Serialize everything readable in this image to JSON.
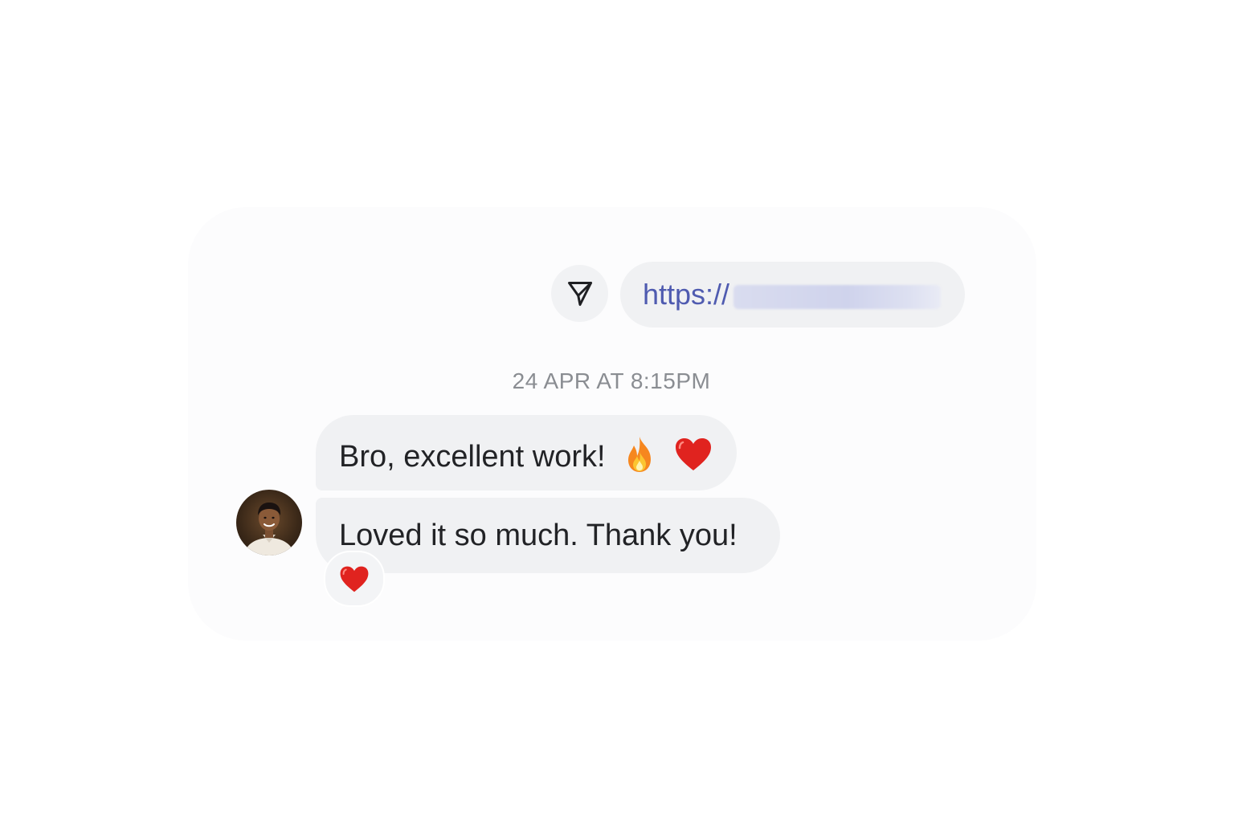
{
  "conversation": {
    "outgoing_link": {
      "text": "https://",
      "share_icon": "send-paper-plane-icon",
      "link_color": "#4f5bb0"
    },
    "timestamp": "24 APR AT 8:15PM",
    "messages": [
      {
        "text": "Bro, excellent work!",
        "emojis": [
          "fire-emoji",
          "red-heart-emoji"
        ]
      },
      {
        "text": "Loved it so much. Thank you!"
      }
    ],
    "reaction": {
      "emoji": "red-heart-emoji"
    },
    "colors": {
      "bubble": "#f0f1f3",
      "text": "#222326",
      "timestamp": "#8a8d92",
      "heart": "#e0231f"
    }
  }
}
